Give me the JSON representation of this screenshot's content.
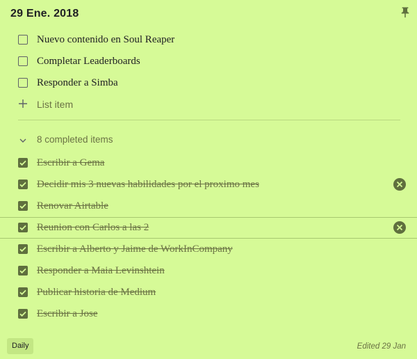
{
  "note": {
    "title": "29 Ene. 2018",
    "pin_icon": "pin-icon",
    "open_items": [
      {
        "label": "Nuevo contenido en Soul Reaper",
        "checked": false
      },
      {
        "label": "Completar Leaderboards",
        "checked": false
      },
      {
        "label": "Responder a Simba",
        "checked": false
      }
    ],
    "add_item_label": "List item",
    "completed_header": "8 completed items",
    "completed_items": [
      {
        "label": "Escribir a Gema",
        "checked": true,
        "remove_visible": false
      },
      {
        "label": "Decidir mis 3 nuevas habilidades por el proximo mes",
        "checked": true,
        "remove_visible": true
      },
      {
        "label": "Renovar Airtable",
        "checked": true,
        "remove_visible": false
      },
      {
        "label": "Reunion con Carlos a las 2",
        "checked": true,
        "remove_visible": true
      },
      {
        "label": "Escribir a Alberto y Jaime de WorkInCompany",
        "checked": true,
        "remove_visible": false
      },
      {
        "label": "Responder a Maia Levinshtein",
        "checked": true,
        "remove_visible": false
      },
      {
        "label": "Publicar historia de Medium",
        "checked": true,
        "remove_visible": false
      },
      {
        "label": "Escribir a Jose",
        "checked": true,
        "remove_visible": false
      }
    ],
    "label_chip": "Daily",
    "edited": "Edited 29 Jan"
  },
  "colors": {
    "note_background": "#d6fa97",
    "checkbox_fill": "#5f6f3e",
    "muted_text": "#6b7345"
  }
}
